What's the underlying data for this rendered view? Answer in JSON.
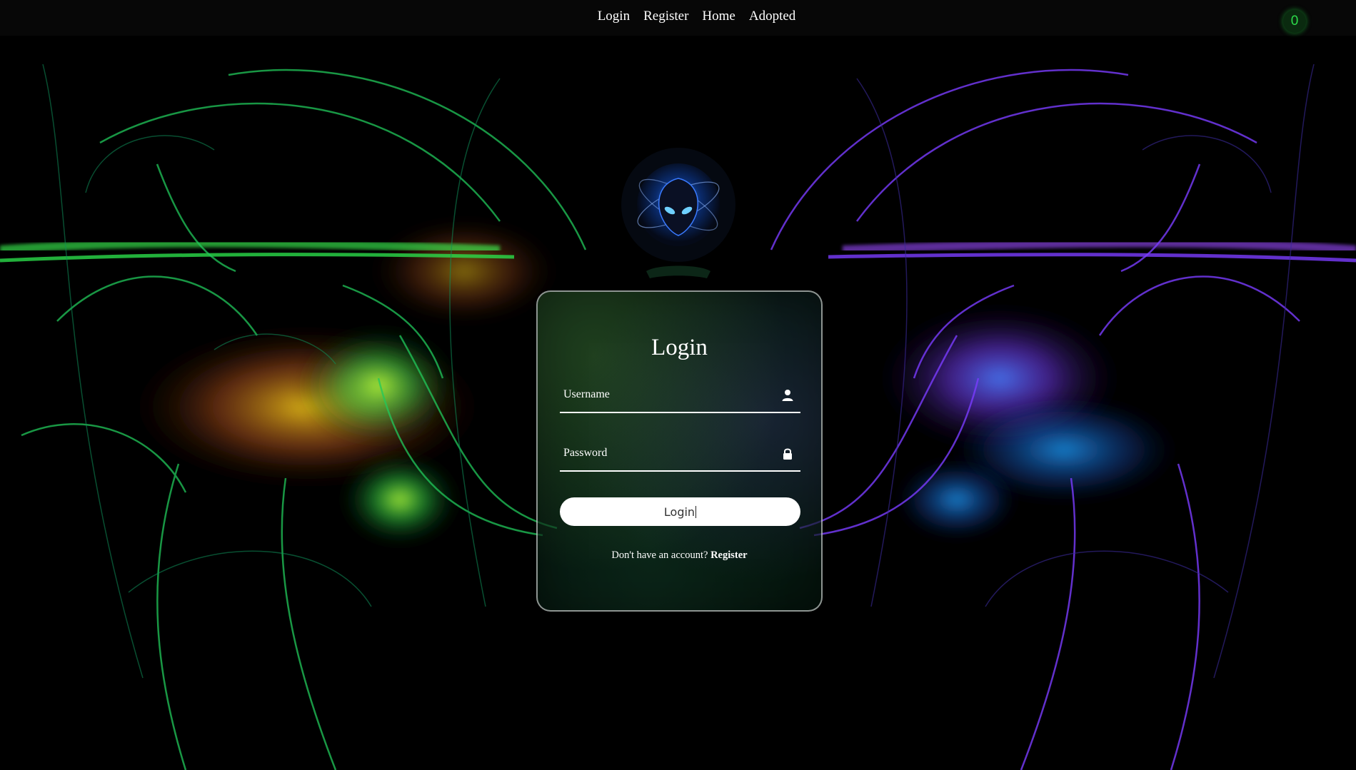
{
  "nav": {
    "links": [
      "Login",
      "Register",
      "Home",
      "Adopted"
    ]
  },
  "cart": {
    "count": "0",
    "color": "#2ddc4a"
  },
  "login_form": {
    "title": "Login",
    "username_placeholder": "Username",
    "username_value": "",
    "password_placeholder": "Password",
    "password_value": "",
    "submit_label": "Login",
    "register_prompt": "Don't have an account?",
    "register_link": "Register"
  },
  "icons": {
    "username": "user-icon",
    "password": "lock-icon",
    "logo": "alien-globe-icon"
  },
  "colors": {
    "nav_bg": "#070707",
    "text": "#ffffff",
    "left_swirl": "#2bdc4a",
    "right_swirl": "#7a3cff"
  }
}
